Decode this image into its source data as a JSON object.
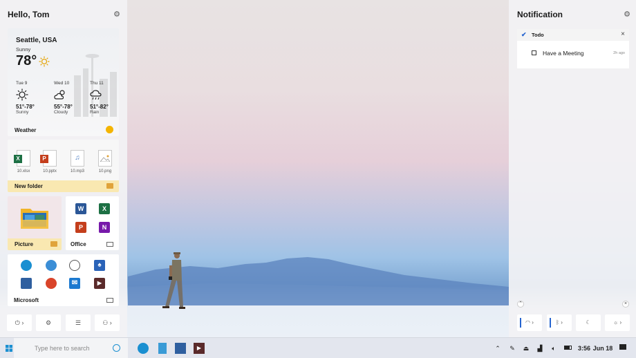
{
  "left_panel": {
    "greeting": "Hello, Tom",
    "weather": {
      "city": "Seattle, USA",
      "condition": "Sunny",
      "temperature": "78°",
      "forecast": [
        {
          "day": "Tue 9",
          "range": "51°-78°",
          "condition": "Sunny",
          "icon": "sun-icon"
        },
        {
          "day": "Wed 10",
          "range": "55°-78°",
          "condition": "Cloudy",
          "icon": "cloud-sun-icon"
        },
        {
          "day": "Thu 11",
          "range": "51°-82°",
          "condition": "Rain",
          "icon": "rain-icon"
        }
      ],
      "label": "Weather"
    },
    "folder": {
      "files": [
        {
          "name": "10.xlsx",
          "icon": "excel-file-icon",
          "color": "#1d7044"
        },
        {
          "name": "10.pptx",
          "icon": "powerpoint-file-icon",
          "color": "#c43e1c"
        },
        {
          "name": "10.mp3",
          "icon": "music-file-icon",
          "color": "#4a7cc0"
        },
        {
          "name": "10.png",
          "icon": "image-file-icon",
          "color": "#e0a33a"
        }
      ],
      "label": "New folder"
    },
    "picture_label": "Picture",
    "office": {
      "label": "Office",
      "apps": [
        {
          "icon": "word-icon",
          "letter": "W",
          "color": "#2b5797"
        },
        {
          "icon": "excel-icon",
          "letter": "X",
          "color": "#1d7044"
        },
        {
          "icon": "powerpoint-icon",
          "letter": "P",
          "color": "#c43e1c"
        },
        {
          "icon": "onenote-icon",
          "letter": "N",
          "color": "#7719aa"
        }
      ]
    },
    "microsoft": {
      "label": "Microsoft",
      "apps": [
        {
          "icon": "edge-icon",
          "color": "#1a8fd1"
        },
        {
          "icon": "globe-icon",
          "color": "#3b8ed6"
        },
        {
          "icon": "clock-icon",
          "color": "#6b6b6b"
        },
        {
          "icon": "solitaire-icon",
          "color": "#2a63b8"
        },
        {
          "icon": "photos-icon",
          "color": "#2f5f9f"
        },
        {
          "icon": "maps-icon",
          "color": "#d9442a"
        },
        {
          "icon": "mail-icon",
          "color": "#1b79d0"
        },
        {
          "icon": "movies-icon",
          "color": "#5a2a2a"
        }
      ]
    },
    "quick_buttons": [
      {
        "icon": "power-icon",
        "glyph": "⏻",
        "chevron": "›"
      },
      {
        "icon": "settings-icon",
        "glyph": "⚙",
        "chevron": ""
      },
      {
        "icon": "list-icon",
        "glyph": "☰",
        "chevron": ""
      },
      {
        "icon": "user-switch-icon",
        "glyph": "⚇",
        "chevron": "›"
      }
    ]
  },
  "right_panel": {
    "title": "Notification",
    "todo": {
      "app": "Todo",
      "task": "Have a Meeting",
      "time": "2h ago"
    },
    "quick_buttons": [
      {
        "icon": "wifi-icon",
        "glyph": "◠",
        "chevron": "›"
      },
      {
        "icon": "bluetooth-icon",
        "glyph": "ᛒ",
        "chevron": "›"
      },
      {
        "icon": "focus-assist-icon",
        "glyph": "☾",
        "chevron": ""
      },
      {
        "icon": "brightness-icon",
        "glyph": "☼",
        "chevron": "›"
      }
    ]
  },
  "taskbar": {
    "search_placeholder": "Type here to search",
    "pinned": [
      "edge-icon",
      "notepad-icon",
      "photos-icon",
      "movies-icon"
    ],
    "time": "3:56",
    "date": "Jun 18"
  }
}
